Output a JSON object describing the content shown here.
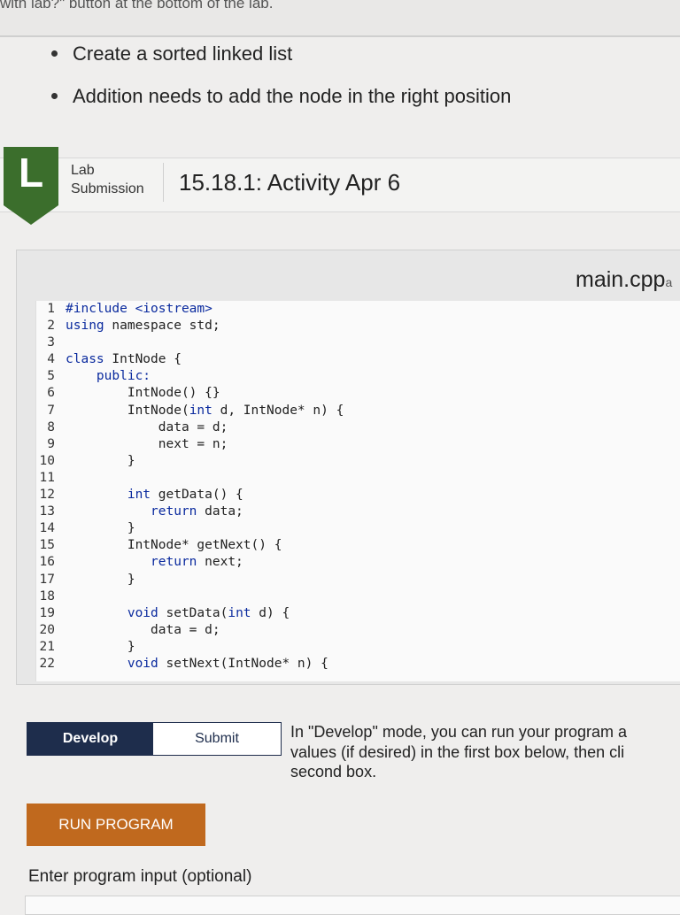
{
  "top_strip": {
    "text": "with lab?\" button at the bottom of the lab."
  },
  "bullets": [
    "Create a sorted linked list",
    "Addition needs to add the node in the right position"
  ],
  "lab": {
    "badge_letter": "L",
    "kind_line1": "Lab",
    "kind_line2": "Submission",
    "title": "15.18.1: Activity Apr 6",
    "badge_color": "#3b6e2c"
  },
  "editor": {
    "file_name": "main.cpp",
    "file_name_extra": "a",
    "lines": [
      {
        "n": "1",
        "parts": [
          [
            "kw",
            "#include <iostream>"
          ]
        ]
      },
      {
        "n": "2",
        "parts": [
          [
            "kw",
            "using"
          ],
          [
            "tx",
            " namespace std;"
          ]
        ]
      },
      {
        "n": "3",
        "parts": []
      },
      {
        "n": "4",
        "parts": [
          [
            "kw",
            "class"
          ],
          [
            "tx",
            " IntNode {"
          ]
        ]
      },
      {
        "n": "5",
        "parts": [
          [
            "kw",
            "    public:"
          ]
        ]
      },
      {
        "n": "6",
        "parts": [
          [
            "tx",
            "        IntNode() {}"
          ]
        ]
      },
      {
        "n": "7",
        "parts": [
          [
            "tx",
            "        IntNode("
          ],
          [
            "kw",
            "int"
          ],
          [
            "tx",
            " d, IntNode* n) {"
          ]
        ]
      },
      {
        "n": "8",
        "parts": [
          [
            "tx",
            "            data = d;"
          ]
        ]
      },
      {
        "n": "9",
        "parts": [
          [
            "tx",
            "            next = n;"
          ]
        ]
      },
      {
        "n": "10",
        "parts": [
          [
            "tx",
            "        }"
          ]
        ]
      },
      {
        "n": "11",
        "parts": []
      },
      {
        "n": "12",
        "parts": [
          [
            "kw",
            "        int"
          ],
          [
            "tx",
            " getData() {"
          ]
        ]
      },
      {
        "n": "13",
        "parts": [
          [
            "kw",
            "           return"
          ],
          [
            "tx",
            " data;"
          ]
        ]
      },
      {
        "n": "14",
        "parts": [
          [
            "tx",
            "        }"
          ]
        ]
      },
      {
        "n": "15",
        "parts": [
          [
            "tx",
            "        IntNode* getNext() {"
          ]
        ]
      },
      {
        "n": "16",
        "parts": [
          [
            "kw",
            "           return"
          ],
          [
            "tx",
            " next;"
          ]
        ]
      },
      {
        "n": "17",
        "parts": [
          [
            "tx",
            "        }"
          ]
        ]
      },
      {
        "n": "18",
        "parts": []
      },
      {
        "n": "19",
        "parts": [
          [
            "kw",
            "        void"
          ],
          [
            "tx",
            " setData("
          ],
          [
            "kw",
            "int"
          ],
          [
            "tx",
            " d) {"
          ]
        ]
      },
      {
        "n": "20",
        "parts": [
          [
            "tx",
            "           data = d;"
          ]
        ]
      },
      {
        "n": "21",
        "parts": [
          [
            "tx",
            "        }"
          ]
        ]
      },
      {
        "n": "22",
        "parts": [
          [
            "kw",
            "        void"
          ],
          [
            "tx",
            " setNext(IntNode* n) {"
          ]
        ]
      }
    ]
  },
  "modes": {
    "develop_label": "Develop",
    "submit_label": "Submit",
    "description": "In \"Develop\" mode, you can run your program a\nvalues (if desired) in the first box below, then cli\nsecond box."
  },
  "run": {
    "label": "RUN PROGRAM",
    "color": "#c0691e"
  },
  "program_input": {
    "label": "Enter program input (optional)"
  }
}
